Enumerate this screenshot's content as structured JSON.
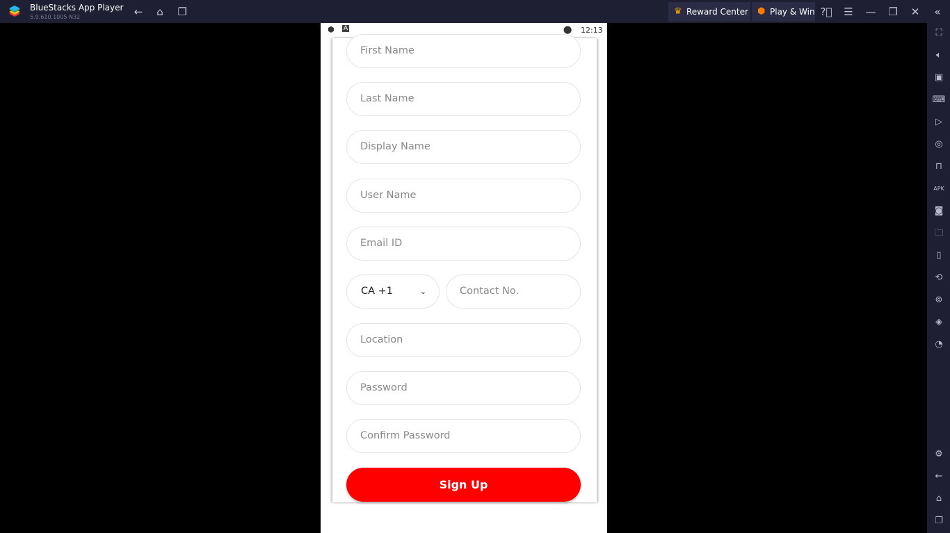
{
  "titlebar": {
    "app_name": "BlueStacks App Player",
    "version": "5.9.610.1005 N32",
    "reward_center": "Reward Center",
    "play_win": "Play & Win"
  },
  "status": {
    "time": "12:13"
  },
  "form": {
    "first_name": "First Name",
    "last_name": "Last Name",
    "display_name": "Display Name",
    "user_name": "User Name",
    "email": "Email ID",
    "country_code": "CA +1",
    "contact": "Contact No.",
    "location": "Location",
    "password": "Password",
    "confirm_password": "Confirm Password",
    "signup": "Sign Up"
  },
  "colors": {
    "accent": "#ff0000",
    "chrome": "#1e1f33"
  }
}
